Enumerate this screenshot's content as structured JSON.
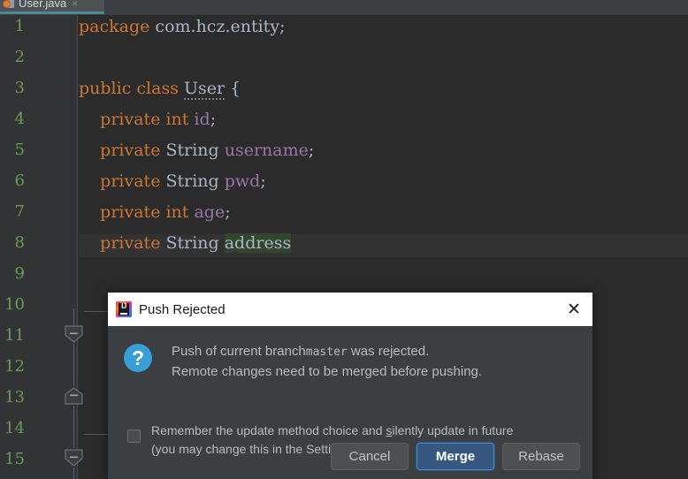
{
  "tab": {
    "label": "User.java",
    "close_glyph": "×",
    "icon": "java-class-icon",
    "underline_color": "#4a8c96"
  },
  "editor": {
    "gutter_line_numbers": [
      "1",
      "2",
      "3",
      "4",
      "5",
      "6",
      "7",
      "8",
      "9",
      "10",
      "11",
      "12",
      "13",
      "14",
      "15"
    ],
    "lines": [
      {
        "num": "1",
        "tokens": [
          {
            "t": "package",
            "c": "kw"
          },
          {
            "t": " com.hcz.entity;",
            "c": "plain"
          }
        ]
      },
      {
        "num": "2",
        "tokens": []
      },
      {
        "num": "3",
        "tokens": [
          {
            "t": "public",
            "c": "kw"
          },
          {
            "t": " ",
            "c": "plain"
          },
          {
            "t": "class",
            "c": "kw"
          },
          {
            "t": " ",
            "c": "plain"
          },
          {
            "t": "User",
            "c": "cls-warn"
          },
          {
            "t": " {",
            "c": "plain"
          }
        ]
      },
      {
        "num": "4",
        "tokens": [
          {
            "t": "    ",
            "c": "plain"
          },
          {
            "t": "private",
            "c": "kw"
          },
          {
            "t": " ",
            "c": "plain"
          },
          {
            "t": "int",
            "c": "kw"
          },
          {
            "t": " ",
            "c": "plain"
          },
          {
            "t": "id",
            "c": "field"
          },
          {
            "t": ";",
            "c": "plain"
          }
        ]
      },
      {
        "num": "5",
        "tokens": [
          {
            "t": "    ",
            "c": "plain"
          },
          {
            "t": "private",
            "c": "kw"
          },
          {
            "t": " String ",
            "c": "plain"
          },
          {
            "t": "username",
            "c": "field"
          },
          {
            "t": ";",
            "c": "plain"
          }
        ]
      },
      {
        "num": "6",
        "tokens": [
          {
            "t": "    ",
            "c": "plain"
          },
          {
            "t": "private",
            "c": "kw"
          },
          {
            "t": " String ",
            "c": "plain"
          },
          {
            "t": "pwd",
            "c": "field"
          },
          {
            "t": ";",
            "c": "plain"
          }
        ]
      },
      {
        "num": "7",
        "tokens": [
          {
            "t": "    ",
            "c": "plain"
          },
          {
            "t": "private",
            "c": "kw"
          },
          {
            "t": " ",
            "c": "plain"
          },
          {
            "t": "int",
            "c": "kw"
          },
          {
            "t": " ",
            "c": "plain"
          },
          {
            "t": "age",
            "c": "field"
          },
          {
            "t": ";",
            "c": "plain"
          }
        ]
      },
      {
        "num": "8",
        "tokens": [
          {
            "t": "    ",
            "c": "plain"
          },
          {
            "t": "private",
            "c": "kw"
          },
          {
            "t": " String ",
            "c": "plain"
          },
          {
            "t": "address",
            "c": "plain sel"
          }
        ]
      }
    ],
    "selected_text": "address",
    "caret_line": "8",
    "fold_markers": [
      "collapse-minus",
      "collapse-minus",
      "collapse-minus"
    ]
  },
  "dialog": {
    "title": "Push Rejected",
    "close_glyph": "✕",
    "icon": "intellij-idea-logo-icon",
    "info_icon": "question-mark-icon",
    "info_glyph": "?",
    "message_line1_prefix": "Push of current branch",
    "message_branch": "master",
    "message_line1_suffix": " was rejected.",
    "message_line2": "Remote changes need to be merged before pushing.",
    "remember_label_part1": "Remember the update method choice and ",
    "remember_mnemonic": "s",
    "remember_label_part2": "ilently update in future",
    "remember_label_line2": "(you may change this in the Settings)",
    "remember_checked": false,
    "buttons": [
      {
        "label": "Cancel",
        "style": "default",
        "name": "cancel-button"
      },
      {
        "label": "Merge",
        "style": "primary",
        "name": "merge-button"
      },
      {
        "label": "Rebase",
        "style": "default",
        "name": "rebase-button"
      }
    ],
    "accent_color": "#365880",
    "info_icon_color": "#389fd6"
  }
}
